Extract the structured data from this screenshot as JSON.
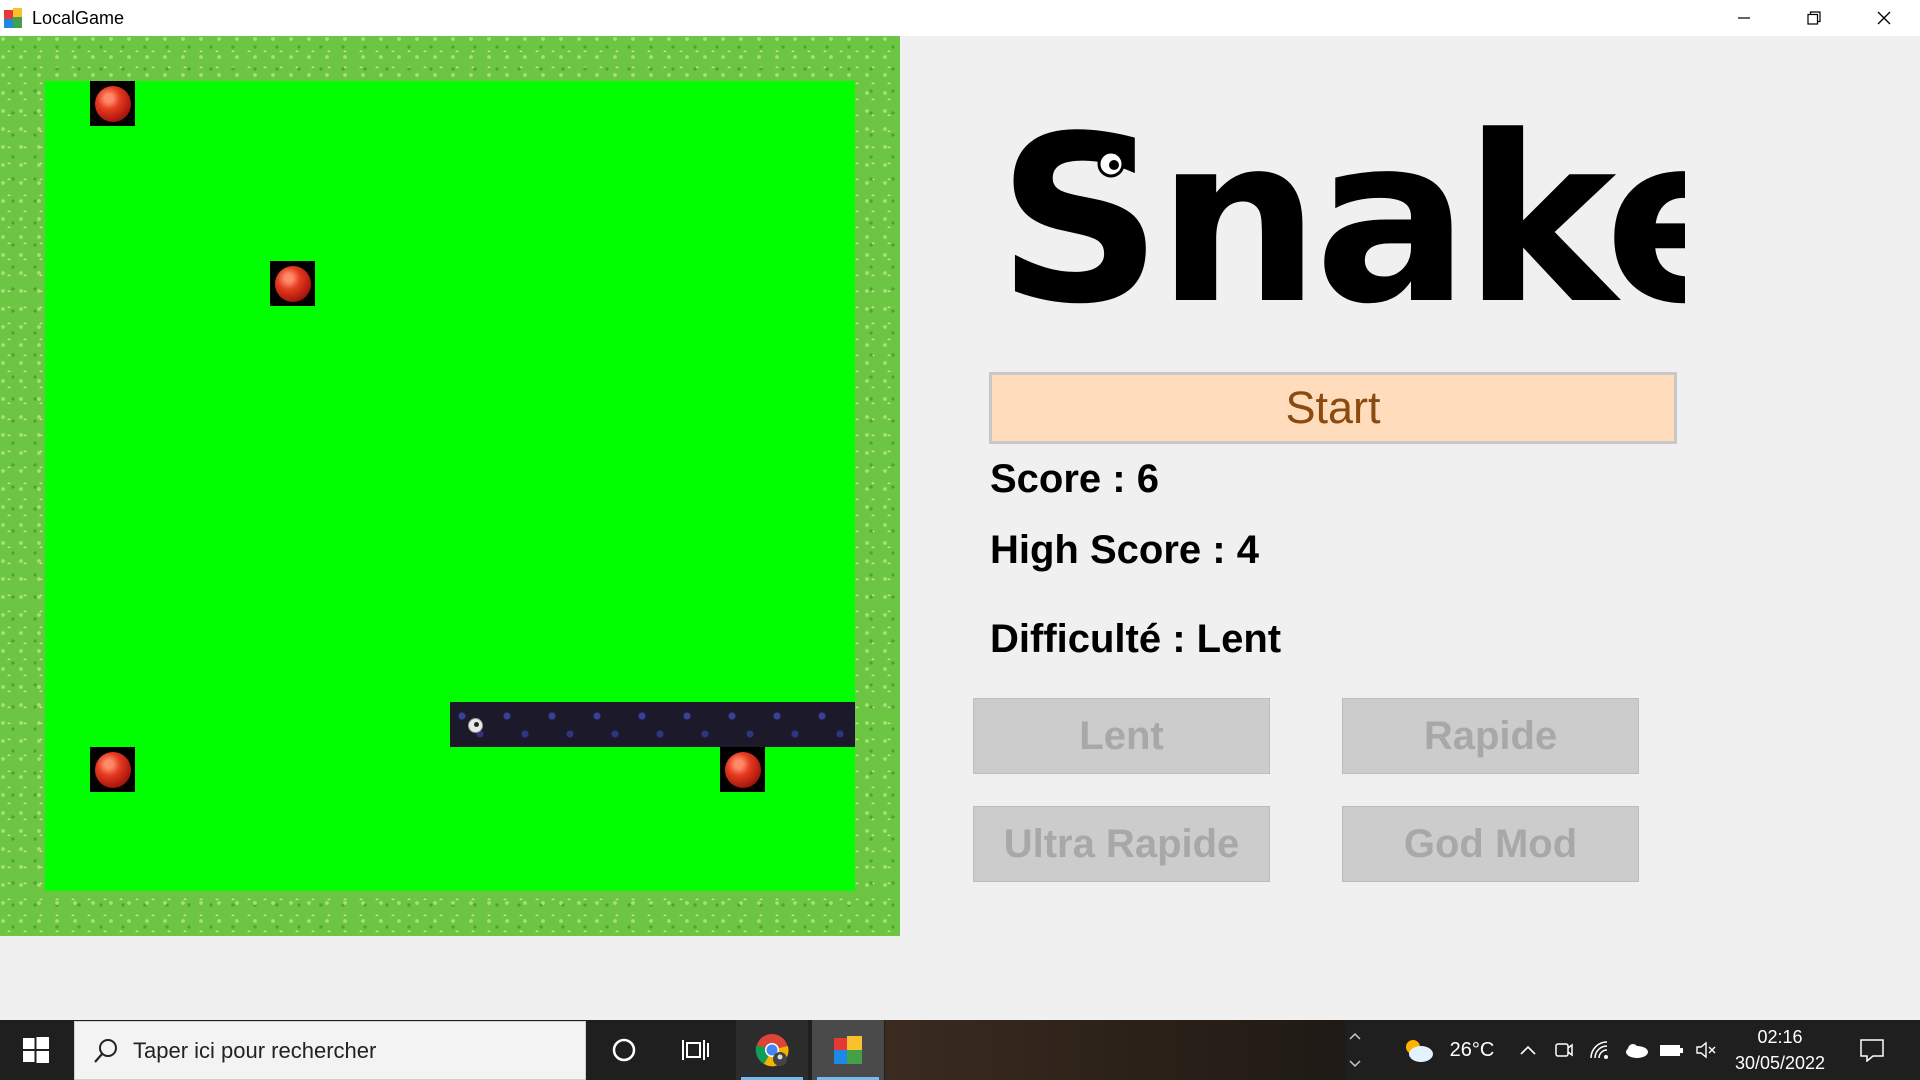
{
  "window": {
    "title": "LocalGame",
    "controls": [
      "minimize",
      "restore",
      "close"
    ]
  },
  "game": {
    "apples": 4,
    "snake_direction": "left",
    "snake_length": 9
  },
  "panel": {
    "logo_text": "Snake",
    "start_label": "Start",
    "score_label": "Score : 6",
    "high_score_label": "High Score : 4",
    "difficulty_label": "Difficulté : Lent",
    "difficulty_buttons": [
      "Lent",
      "Rapide",
      "Ultra Rapide",
      "God Mod"
    ]
  },
  "taskbar": {
    "search_placeholder": "Taper ici pour rechercher",
    "weather_temp": "26°C",
    "time": "02:16",
    "date": "30/05/2022"
  },
  "colors": {
    "start_bg": "#ffdcbc",
    "start_text": "#8a4a10",
    "field": "#00ff00",
    "border_grass": "#6cc644",
    "disabled_button": "#cccccc"
  }
}
